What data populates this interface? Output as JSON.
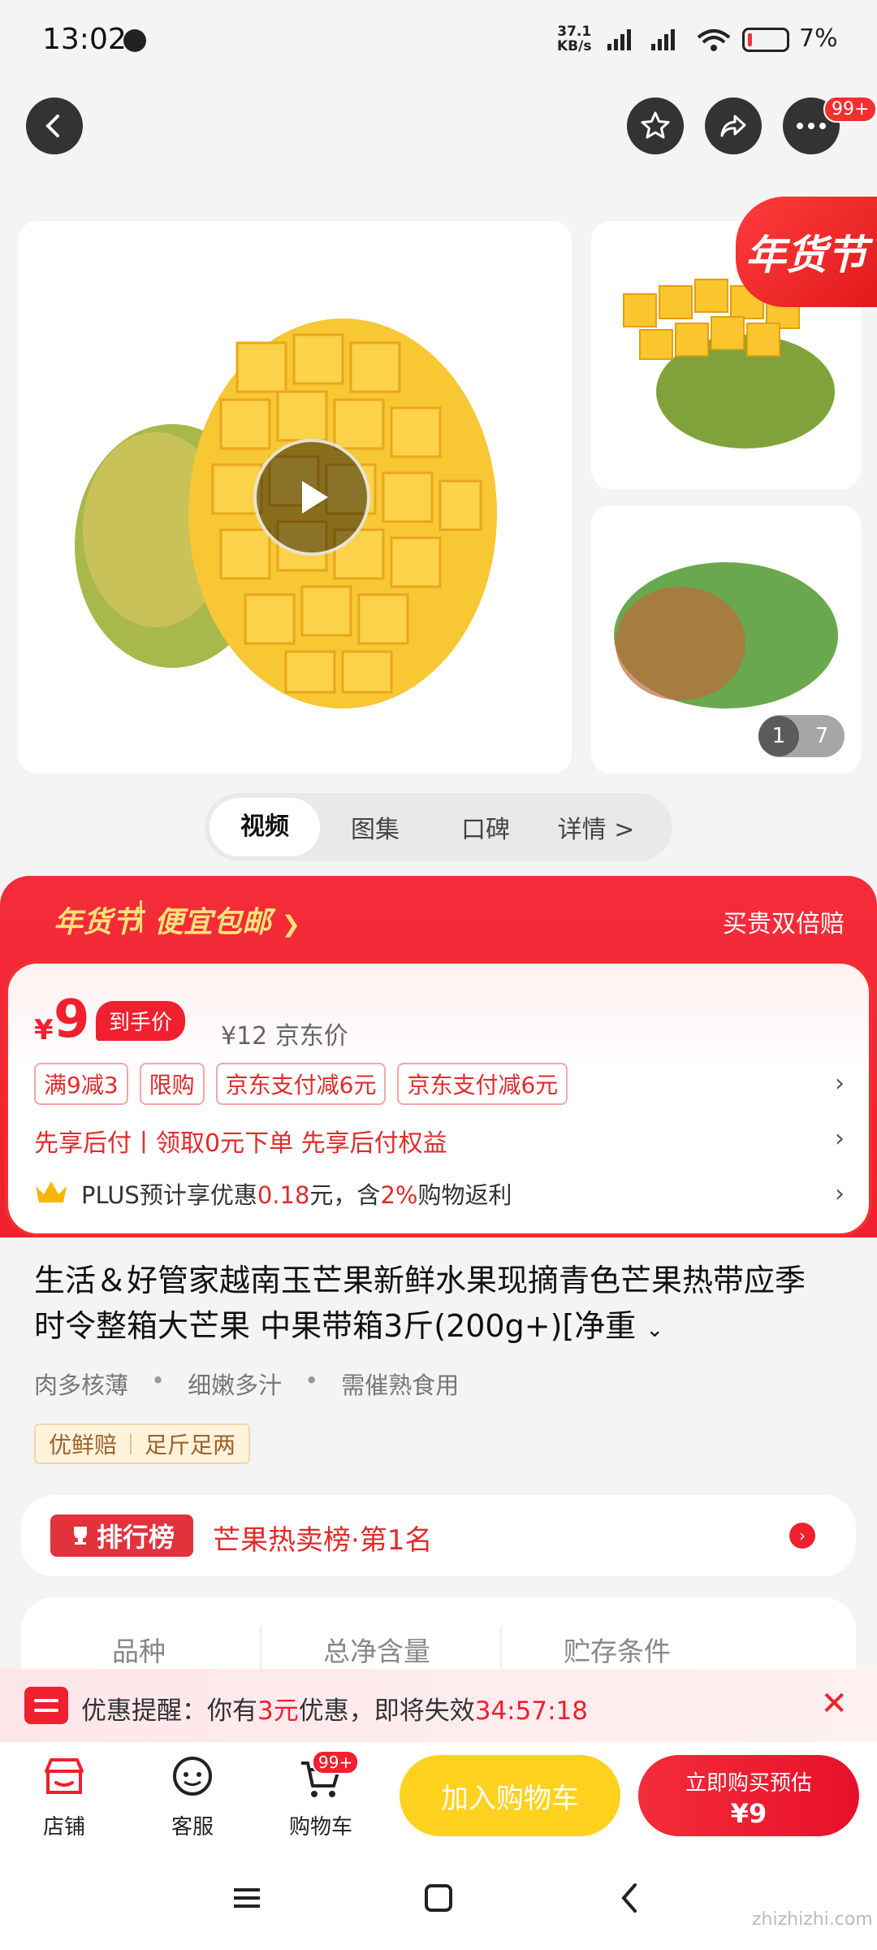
{
  "status_bar": {
    "time": "13:02",
    "net_speed_value": "37.1",
    "net_speed_unit": "KB/s",
    "battery": "7%"
  },
  "nav": {
    "badge": "99+"
  },
  "gallery": {
    "counter_current": "1",
    "counter_total": "7",
    "festival_badge": "年货节"
  },
  "tabs": [
    {
      "label": "视频",
      "active": true
    },
    {
      "label": "图集"
    },
    {
      "label": "口碑"
    },
    {
      "label": "详情 >"
    }
  ],
  "promo": {
    "festival": "年货节",
    "free_shipping": "便宜包邮",
    "guarantee": "买贵双倍赔",
    "price_symbol": "¥",
    "price": "9",
    "price_tag": "到手价",
    "original_price": "¥12 京东价",
    "chips": [
      "满9减3",
      "限购",
      "京东支付减6元",
      "京东支付减6元"
    ],
    "pay_later": "先享后付丨领取0元下单 先享后付权益",
    "plus_prefix": "PLUS预计享优惠",
    "plus_amount": "0.18",
    "plus_mid": "元，含",
    "plus_pct": "2%",
    "plus_suffix": "购物返利"
  },
  "product": {
    "title": "生活＆好管家越南玉芒果新鲜水果现摘青色芒果热带应季时令整箱大芒果 中果带箱3斤(200g+)[净重",
    "features": [
      "肉多核薄",
      "细嫩多汁",
      "需催熟食用"
    ],
    "tags": [
      "优鲜赔",
      "足斤足两"
    ]
  },
  "ranking": {
    "badge": "排行榜",
    "text": "芒果热卖榜·第1名"
  },
  "specs": [
    "品种",
    "总净含量",
    "贮存条件"
  ],
  "coupon": {
    "prefix": "优惠提醒：你有",
    "amount": "3元",
    "middle": "优惠，即将失效",
    "countdown": "34:57:18"
  },
  "bottom_bar": {
    "shop": "店铺",
    "service": "客服",
    "cart": "购物车",
    "cart_badge": "99+",
    "add_to_cart": "加入购物车",
    "buy_now": "立即购买预估",
    "buy_price": "¥9"
  },
  "watermark": "zhizhizhi.com",
  "colors": {
    "brand_red": "#f0202e",
    "button_yellow": "#ffd21f"
  }
}
